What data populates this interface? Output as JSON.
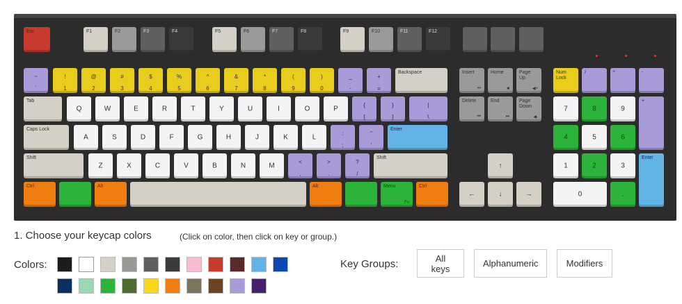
{
  "keycap_colors": {
    "white": "#f4f4f4",
    "beige": "#d4d0c6",
    "gray": "#9a9a98",
    "dark_gray": "#5f605d",
    "charcoal": "#3a3a3a",
    "red": "#c83a2e",
    "yellow": "#e8cd1d",
    "purple": "#a99ad8",
    "blue": "#63b4e6",
    "green": "#2bb33a",
    "orange": "#f07d0f"
  },
  "keyboard": {
    "keys": [
      {
        "id": "esc",
        "legend": "Esc",
        "color": "red"
      },
      {
        "id": "f1",
        "legend": "F1",
        "color": "beige"
      },
      {
        "id": "f2",
        "legend": "F2",
        "color": "gray"
      },
      {
        "id": "f3",
        "legend": "F3",
        "color": "dark_gray"
      },
      {
        "id": "f4",
        "legend": "F4",
        "color": "charcoal"
      },
      {
        "id": "f5",
        "legend": "F5",
        "color": "beige"
      },
      {
        "id": "f6",
        "legend": "F6",
        "color": "gray"
      },
      {
        "id": "f7",
        "legend": "F7",
        "color": "dark_gray"
      },
      {
        "id": "f8",
        "legend": "F8",
        "color": "charcoal"
      },
      {
        "id": "f9",
        "legend": "F9",
        "color": "beige"
      },
      {
        "id": "f10",
        "legend": "F10",
        "color": "gray"
      },
      {
        "id": "f11",
        "legend": "F11",
        "color": "dark_gray"
      },
      {
        "id": "f12",
        "legend": "F12",
        "color": "charcoal"
      },
      {
        "id": "prtsc",
        "legend": "",
        "color": "dark_gray"
      },
      {
        "id": "scrlk",
        "legend": "",
        "color": "dark_gray"
      },
      {
        "id": "pause",
        "legend": "",
        "color": "dark_gray"
      },
      {
        "id": "tilde",
        "legend": "~\n`",
        "color": "purple"
      },
      {
        "id": "1",
        "legend": "!\n1",
        "color": "yellow"
      },
      {
        "id": "2",
        "legend": "@\n2",
        "color": "yellow"
      },
      {
        "id": "3",
        "legend": "#\n3",
        "color": "yellow"
      },
      {
        "id": "4",
        "legend": "$\n4",
        "color": "yellow"
      },
      {
        "id": "5",
        "legend": "%\n5",
        "color": "yellow"
      },
      {
        "id": "6",
        "legend": "^\n6",
        "color": "yellow"
      },
      {
        "id": "7",
        "legend": "&\n7",
        "color": "yellow"
      },
      {
        "id": "8",
        "legend": "*\n8",
        "color": "yellow"
      },
      {
        "id": "9",
        "legend": "(\n9",
        "color": "yellow"
      },
      {
        "id": "0",
        "legend": ")\n0",
        "color": "yellow"
      },
      {
        "id": "minus",
        "legend": "_\n-",
        "color": "purple"
      },
      {
        "id": "equal",
        "legend": "+\n=",
        "color": "purple"
      },
      {
        "id": "backspace",
        "legend": "Backspace",
        "color": "beige"
      },
      {
        "id": "tab",
        "legend": "Tab",
        "color": "beige"
      },
      {
        "id": "q",
        "legend": "Q",
        "color": "white"
      },
      {
        "id": "w",
        "legend": "W",
        "color": "white"
      },
      {
        "id": "e",
        "legend": "E",
        "color": "white"
      },
      {
        "id": "r",
        "legend": "R",
        "color": "white"
      },
      {
        "id": "t",
        "legend": "T",
        "color": "white"
      },
      {
        "id": "y",
        "legend": "Y",
        "color": "white"
      },
      {
        "id": "u",
        "legend": "U",
        "color": "white"
      },
      {
        "id": "i",
        "legend": "I",
        "color": "white"
      },
      {
        "id": "o",
        "legend": "O",
        "color": "white"
      },
      {
        "id": "p",
        "legend": "P",
        "color": "white"
      },
      {
        "id": "lbracket",
        "legend": "{\n[",
        "color": "purple"
      },
      {
        "id": "rbracket",
        "legend": "}\n]",
        "color": "purple"
      },
      {
        "id": "backslash",
        "legend": "|\n\\",
        "color": "purple"
      },
      {
        "id": "capslock",
        "legend": "Caps Lock",
        "color": "beige"
      },
      {
        "id": "a",
        "legend": "A",
        "color": "white"
      },
      {
        "id": "s",
        "legend": "S",
        "color": "white"
      },
      {
        "id": "d",
        "legend": "D",
        "color": "white"
      },
      {
        "id": "f",
        "legend": "F",
        "color": "white"
      },
      {
        "id": "g",
        "legend": "G",
        "color": "white"
      },
      {
        "id": "h",
        "legend": "H",
        "color": "white"
      },
      {
        "id": "j",
        "legend": "J",
        "color": "white"
      },
      {
        "id": "k",
        "legend": "K",
        "color": "white"
      },
      {
        "id": "l",
        "legend": "L",
        "color": "white"
      },
      {
        "id": "semicolon",
        "legend": ":\n;",
        "color": "purple"
      },
      {
        "id": "quote",
        "legend": "\"\n'",
        "color": "purple"
      },
      {
        "id": "enter",
        "legend": "Enter",
        "color": "blue"
      },
      {
        "id": "lshift",
        "legend": "Shift",
        "color": "beige"
      },
      {
        "id": "z",
        "legend": "Z",
        "color": "white"
      },
      {
        "id": "x",
        "legend": "X",
        "color": "white"
      },
      {
        "id": "c",
        "legend": "C",
        "color": "white"
      },
      {
        "id": "v",
        "legend": "V",
        "color": "white"
      },
      {
        "id": "b",
        "legend": "B",
        "color": "white"
      },
      {
        "id": "n",
        "legend": "N",
        "color": "white"
      },
      {
        "id": "m",
        "legend": "M",
        "color": "white"
      },
      {
        "id": "comma",
        "legend": "<\n,",
        "color": "purple"
      },
      {
        "id": "period",
        "legend": ">\n.",
        "color": "purple"
      },
      {
        "id": "slash",
        "legend": "?\n/",
        "color": "purple"
      },
      {
        "id": "rshift",
        "legend": "Shift",
        "color": "beige"
      },
      {
        "id": "lctrl",
        "legend": "Ctrl",
        "color": "orange"
      },
      {
        "id": "lwin",
        "legend": "",
        "color": "green"
      },
      {
        "id": "lalt",
        "legend": "Alt",
        "color": "orange"
      },
      {
        "id": "space",
        "legend": "",
        "color": "beige"
      },
      {
        "id": "ralt",
        "legend": "Alt",
        "color": "orange"
      },
      {
        "id": "rwin",
        "legend": "",
        "color": "green"
      },
      {
        "id": "menu",
        "legend": "Menu",
        "sub": "Fn",
        "color": "green"
      },
      {
        "id": "rctrl",
        "legend": "Ctrl",
        "color": "orange"
      },
      {
        "id": "insert",
        "legend": "Insert",
        "sub": "⏯",
        "color": "gray"
      },
      {
        "id": "home",
        "legend": "Home",
        "sub": "■",
        "color": "gray"
      },
      {
        "id": "pageup",
        "legend": "Page\nUp",
        "sub": "◀+",
        "color": "gray"
      },
      {
        "id": "delete",
        "legend": "Delete",
        "sub": "⏮",
        "color": "gray"
      },
      {
        "id": "end",
        "legend": "End",
        "sub": "⏭",
        "color": "gray"
      },
      {
        "id": "pagedown",
        "legend": "Page\nDown",
        "sub": "◀-",
        "color": "gray"
      },
      {
        "id": "up",
        "legend": "↑",
        "color": "beige"
      },
      {
        "id": "left",
        "legend": "←",
        "color": "beige"
      },
      {
        "id": "down",
        "legend": "↓",
        "color": "beige"
      },
      {
        "id": "right",
        "legend": "→",
        "color": "beige"
      },
      {
        "id": "numlock",
        "legend": "Num\nLock",
        "color": "yellow"
      },
      {
        "id": "npdiv",
        "legend": "/",
        "color": "purple"
      },
      {
        "id": "npmul",
        "legend": "*",
        "color": "purple"
      },
      {
        "id": "npminus",
        "legend": "-",
        "color": "purple"
      },
      {
        "id": "np7",
        "legend": "7",
        "color": "white"
      },
      {
        "id": "np8",
        "legend": "8",
        "color": "green"
      },
      {
        "id": "np9",
        "legend": "9",
        "color": "white"
      },
      {
        "id": "npplus",
        "legend": "+",
        "color": "purple"
      },
      {
        "id": "np4",
        "legend": "4",
        "color": "green"
      },
      {
        "id": "np5",
        "legend": "5",
        "color": "white"
      },
      {
        "id": "np6",
        "legend": "6",
        "color": "green"
      },
      {
        "id": "np1",
        "legend": "1",
        "color": "white"
      },
      {
        "id": "np2",
        "legend": "2",
        "color": "green"
      },
      {
        "id": "np3",
        "legend": "3",
        "color": "white"
      },
      {
        "id": "npenter",
        "legend": "Enter",
        "color": "blue"
      },
      {
        "id": "np0",
        "legend": "0",
        "color": "white"
      },
      {
        "id": "npdot",
        "legend": ".",
        "color": "green"
      }
    ]
  },
  "section": {
    "heading": "1. Choose your keycap colors",
    "hint": "(Click on color, then click on key or group.)"
  },
  "palette": {
    "label": "Colors:",
    "swatches": [
      "#1c1c1c",
      "#ffffff",
      "#d4d0c6",
      "#999895",
      "#5f605d",
      "#3a3a3a",
      "#f7bcd0",
      "#c83a2e",
      "#5a2a2a",
      "#63b4e6",
      "#0d47b0",
      "#0b2f5e",
      "#9ad9b4",
      "#2bb33a",
      "#4f6b30",
      "#f9d81c",
      "#f07d0f",
      "#7a7460",
      "#6b4423",
      "#a99ad8",
      "#4a1e6e"
    ]
  },
  "key_groups": {
    "label": "Key Groups:",
    "buttons": [
      "All keys",
      "Alphanumeric",
      "Modifiers"
    ]
  }
}
